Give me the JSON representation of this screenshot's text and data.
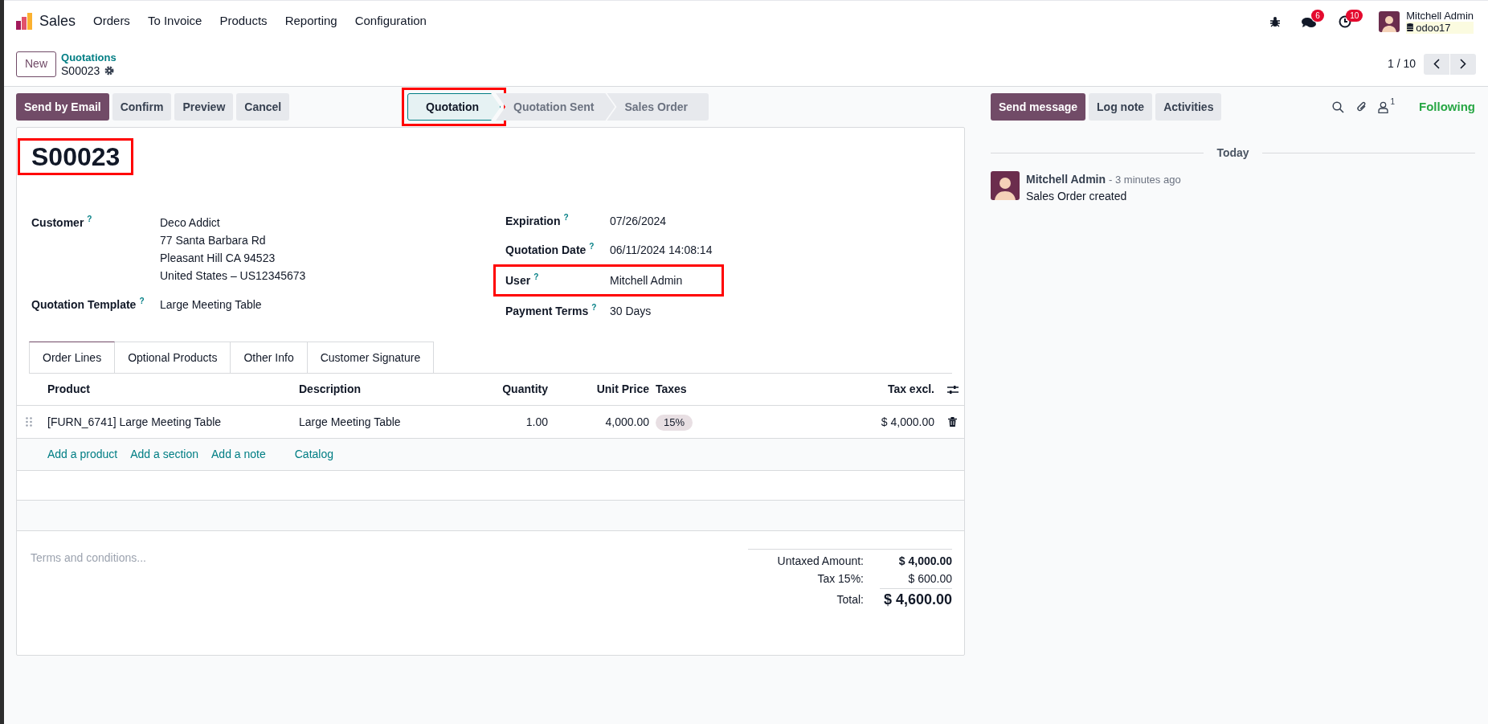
{
  "app_menu": {
    "app_name": "Sales",
    "items": [
      "Orders",
      "To Invoice",
      "Products",
      "Reporting",
      "Configuration"
    ]
  },
  "systray": {
    "messages_count": "6",
    "activities_count": "10",
    "user_name": "Mitchell Admin",
    "database": "odoo17"
  },
  "new_button": "New",
  "breadcrumb": {
    "parent": "Quotations",
    "current": "S00023"
  },
  "pager": {
    "value": "1 / 10"
  },
  "actions": [
    {
      "label": "Send by Email",
      "kind": "primary"
    },
    {
      "label": "Confirm",
      "kind": "secondary"
    },
    {
      "label": "Preview",
      "kind": "secondary"
    },
    {
      "label": "Cancel",
      "kind": "secondary"
    }
  ],
  "stages": [
    {
      "label": "Quotation",
      "selected": true,
      "highlighted": true
    },
    {
      "label": "Quotation Sent",
      "selected": false,
      "highlighted": false
    },
    {
      "label": "Sales Order",
      "selected": false,
      "highlighted": false
    }
  ],
  "record": {
    "title": "S00023",
    "highlighted": true
  },
  "fields_left": [
    {
      "label": "Customer",
      "help": "?",
      "value_lines": [
        "Deco Addict",
        "77 Santa Barbara Rd",
        "Pleasant Hill CA 94523",
        "United States – US12345673"
      ],
      "highlighted": false
    },
    {
      "label": "Quotation Template",
      "help": "?",
      "value_lines": [
        "Large Meeting Table"
      ],
      "highlighted": false
    }
  ],
  "fields_right": [
    {
      "label": "Expiration",
      "help": "?",
      "value_lines": [
        "07/26/2024"
      ],
      "highlighted": false
    },
    {
      "label": "Quotation Date",
      "help": "?",
      "value_lines": [
        "06/11/2024 14:08:14"
      ],
      "highlighted": false
    },
    {
      "label": "User",
      "help": "?",
      "value_lines": [
        "Mitchell Admin"
      ],
      "highlighted": true
    },
    {
      "label": "Payment Terms",
      "help": "?",
      "value_lines": [
        "30 Days"
      ],
      "highlighted": false
    }
  ],
  "tabs": [
    {
      "label": "Order Lines",
      "selected": true
    },
    {
      "label": "Optional Products",
      "selected": false
    },
    {
      "label": "Other Info",
      "selected": false
    },
    {
      "label": "Customer Signature",
      "selected": false
    }
  ],
  "table": {
    "columns": [
      "Product",
      "Description",
      "Quantity",
      "Unit Price",
      "Taxes",
      "Tax excl."
    ],
    "rows": [
      {
        "product": "[FURN_6741] Large Meeting Table",
        "description": "Large Meeting Table",
        "quantity": "1.00",
        "unit_price": "4,000.00",
        "taxes": "15%",
        "tax_excl": "$ 4,000.00"
      }
    ]
  },
  "add_links": [
    "Add a product",
    "Add a section",
    "Add a note",
    "Catalog"
  ],
  "terms": {
    "placeholder": "Terms and conditions..."
  },
  "totals": [
    {
      "label": "Untaxed Amount:",
      "value": "$ 4,000.00",
      "kind": "subtotal"
    },
    {
      "label": "Tax 15%:",
      "value": "$ 600.00",
      "kind": "tax"
    },
    {
      "label": "Total:",
      "value": "$ 4,600.00",
      "kind": "total"
    }
  ],
  "chatter": {
    "buttons": [
      {
        "label": "Send message",
        "kind": "primary"
      },
      {
        "label": "Log note",
        "kind": "secondary"
      },
      {
        "label": "Activities",
        "kind": "secondary"
      }
    ],
    "followers_count": "1",
    "follow_status": "Following",
    "date_separator": "Today",
    "messages": [
      {
        "author": "Mitchell Admin",
        "time": "- 3 minutes ago",
        "body": "Sales Order created"
      }
    ]
  }
}
